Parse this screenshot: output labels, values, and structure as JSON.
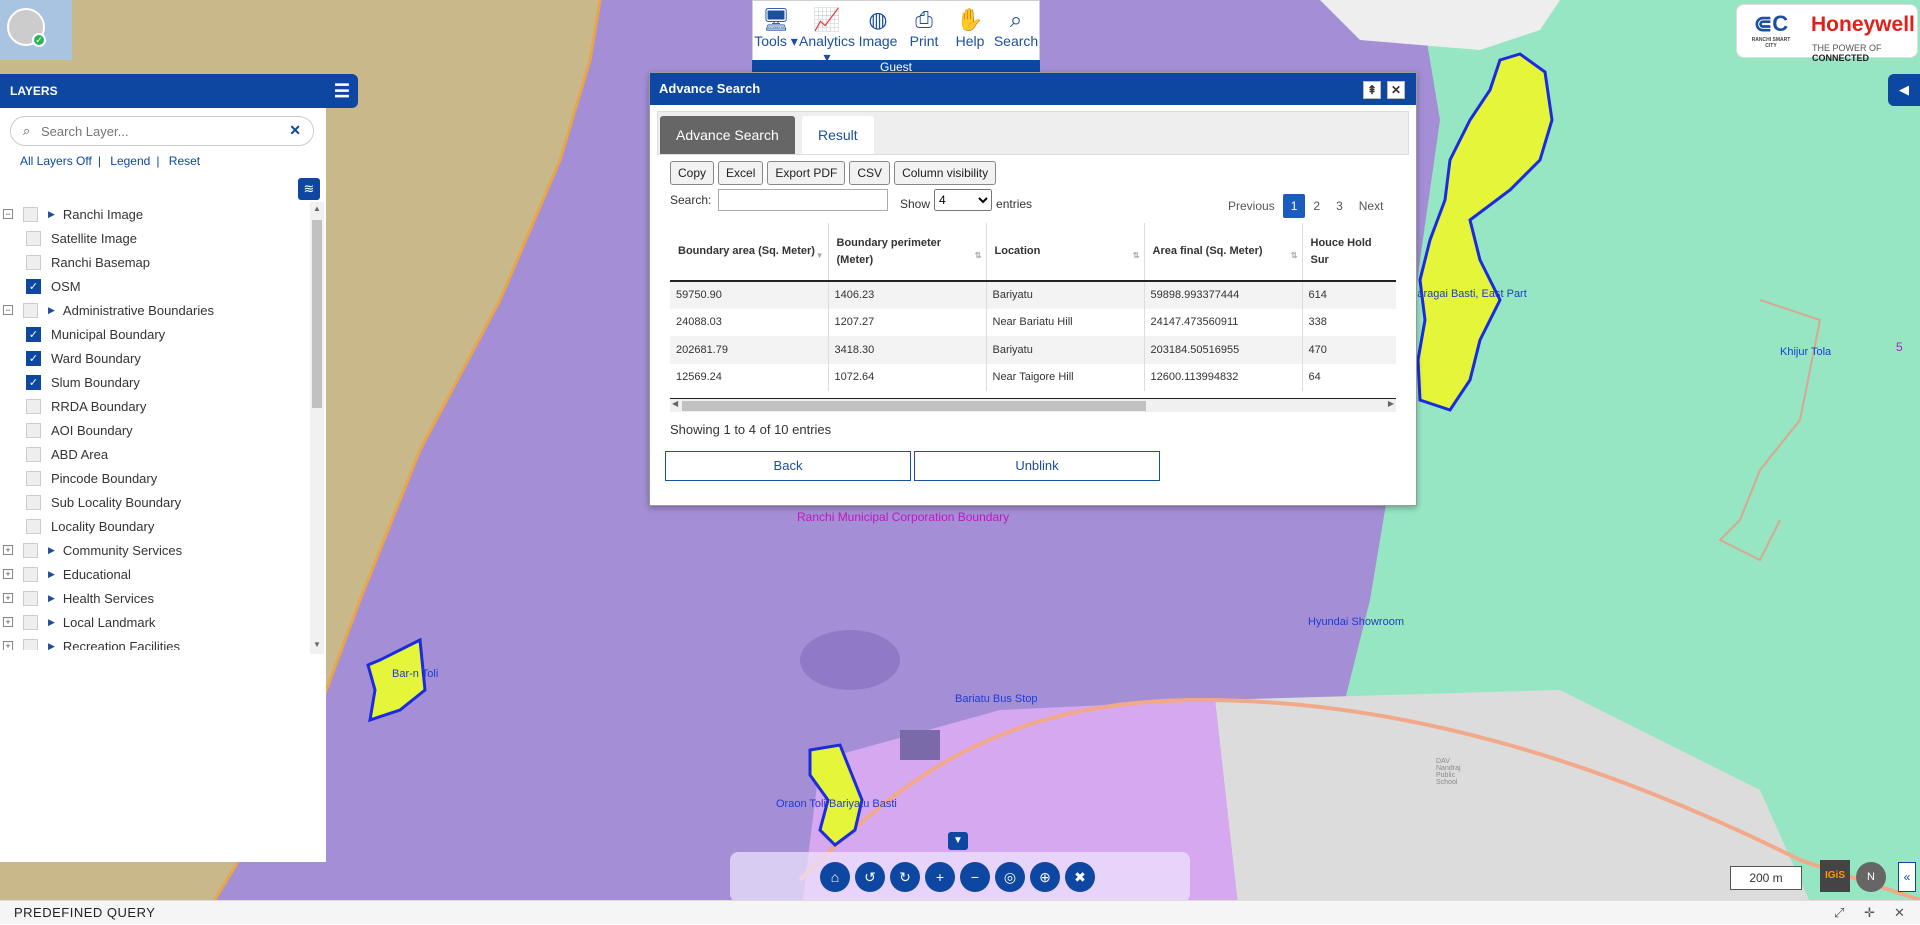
{
  "colors": {
    "primary": "#0d47a1",
    "map_purple": "#a48fd6",
    "slum_fill": "#e4f53a",
    "slum_stroke": "#1a2be0"
  },
  "toolbar": {
    "items": [
      {
        "label": "Tools",
        "icon": "monitor-icon",
        "dropdown": true
      },
      {
        "label": "Analytics",
        "icon": "chart-line-icon",
        "dropdown": true
      },
      {
        "label": "Image",
        "icon": "globe-icon"
      },
      {
        "label": "Print",
        "icon": "printer-icon"
      },
      {
        "label": "Help",
        "icon": "handshake-icon"
      },
      {
        "label": "Search",
        "icon": "search-icon"
      }
    ],
    "user": "Guest"
  },
  "logo": {
    "brand": "Honeywell",
    "tagline_prefix": "THE POWER OF",
    "tagline_bold": "CONNECTED",
    "city_text": "RANCHI SMART CITY"
  },
  "layers": {
    "title": "LAYERS",
    "search_placeholder": "Search Layer...",
    "actions": {
      "off": "All Layers Off",
      "legend": "Legend",
      "reset": "Reset"
    },
    "tree": [
      {
        "label": "Ranchi Image",
        "type": "group",
        "expanded": true
      },
      {
        "label": "Satellite Image",
        "type": "item",
        "checked": false
      },
      {
        "label": "Ranchi Basemap",
        "type": "item",
        "checked": false
      },
      {
        "label": "OSM",
        "type": "item",
        "checked": true
      },
      {
        "label": "Administrative Boundaries",
        "type": "group",
        "expanded": true
      },
      {
        "label": "Municipal Boundary",
        "type": "item",
        "checked": true
      },
      {
        "label": "Ward Boundary",
        "type": "item",
        "checked": true
      },
      {
        "label": "Slum Boundary",
        "type": "item",
        "checked": true
      },
      {
        "label": "RRDA Boundary",
        "type": "item",
        "checked": false
      },
      {
        "label": "AOI Boundary",
        "type": "item",
        "checked": false
      },
      {
        "label": "ABD Area",
        "type": "item",
        "checked": false
      },
      {
        "label": "Pincode Boundary",
        "type": "item",
        "checked": false
      },
      {
        "label": "Sub Locality Boundary",
        "type": "item",
        "checked": false
      },
      {
        "label": "Locality Boundary",
        "type": "item",
        "checked": false
      },
      {
        "label": "Community Services",
        "type": "group",
        "expanded": false
      },
      {
        "label": "Educational",
        "type": "group",
        "expanded": false
      },
      {
        "label": "Health Services",
        "type": "group",
        "expanded": false
      },
      {
        "label": "Local Landmark",
        "type": "group",
        "expanded": false
      },
      {
        "label": "Recreation Facilities",
        "type": "group",
        "expanded": false
      }
    ]
  },
  "dialog": {
    "title": "Advance Search",
    "tabs": [
      "Advance Search",
      "Result"
    ],
    "active_tab": "Result",
    "export_buttons": [
      "Copy",
      "Excel",
      "Export PDF",
      "CSV",
      "Column visibility"
    ],
    "search_label": "Search:",
    "search_value": "",
    "show_label": "Show",
    "entries_value": "4",
    "entries_label": "entries",
    "pagination": {
      "previous": "Previous",
      "pages": [
        "1",
        "2",
        "3"
      ],
      "current": "1",
      "next": "Next"
    },
    "columns": [
      "Boundary area (Sq. Meter)",
      "Boundary perimeter (Meter)",
      "Location",
      "Area final (Sq. Meter)",
      "Houce Hold Sur"
    ],
    "rows": [
      [
        "59750.90",
        "1406.23",
        "Bariyatu",
        "59898.993377444",
        "614"
      ],
      [
        "24088.03",
        "1207.27",
        "Near Bariatu Hill",
        "24147.473560911",
        "338"
      ],
      [
        "202681.79",
        "3418.30",
        "Bariyatu",
        "203184.50516955",
        "470"
      ],
      [
        "12569.24",
        "1072.64",
        "Near Taigore Hill",
        "12600.113994832",
        "64"
      ]
    ],
    "info": "Showing 1 to 4 of 10 entries",
    "back_label": "Back",
    "unblink_label": "Unblink"
  },
  "map_labels": {
    "municipal": "Ranchi Municipal Corporation Boundary",
    "slum_top_right": "Baragai Basti, East Part",
    "khijur": "Khijur Tola",
    "hyundai": "Hyundai Showroom",
    "bus_stop": "Bariatu Bus Stop",
    "oraon": "Oraon Toli Bariyatu Basti",
    "toli": "Bar-n Toli",
    "school": "DAV Nandraj Public School",
    "ward_number": "5"
  },
  "scale": "200 m",
  "bottom_tools": [
    "home-icon",
    "undo-icon",
    "redo-icon",
    "zoom-in-icon",
    "zoom-out-icon",
    "hide-icon",
    "locate-icon",
    "clear-icon"
  ],
  "predefined_query": {
    "label": "PREDEFINED QUERY"
  }
}
